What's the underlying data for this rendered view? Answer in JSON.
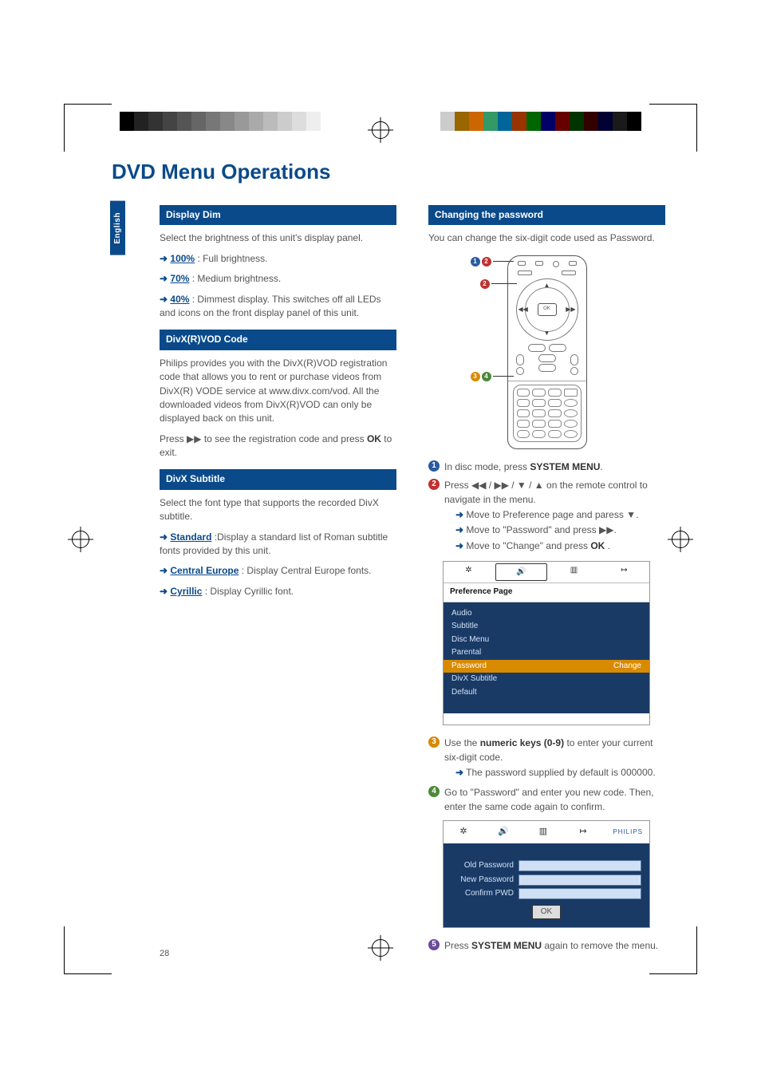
{
  "page_title": "DVD Menu Operations",
  "language_tab": "English",
  "page_number": "28",
  "left": {
    "section1_head": "Display Dim",
    "section1_intro": "Select the brightness of this unit's display panel.",
    "opt_100_label": "100%",
    "opt_100_desc": ": Full brightness.",
    "opt_70_label": "70%",
    "opt_70_desc": ": Medium brightness.",
    "opt_40_label": "40%",
    "opt_40_desc": ": Dimmest display. This switches off all LEDs and icons on the front display panel of this unit.",
    "section2_head": "DivX(R)VOD Code",
    "section2_body": "Philips provides you with the DivX(R)VOD registration code that allows you to rent or purchase videos from DivX(R) VODE service at www.divx.com/vod. All the downloaded videos from DivX(R)VOD can only be displayed back on this unit.",
    "section2_press_a": "Press ",
    "section2_press_b": " to see the registration code and press ",
    "section2_press_ok": "OK",
    "section2_press_c": " to exit.",
    "section3_head": "DivX Subtitle",
    "section3_intro": "Select the font type that supports the recorded DivX subtitle.",
    "opt_std_label": "Standard",
    "opt_std_desc": ":Display a standard list of Roman subtitle fonts provided by this unit.",
    "opt_ce_label": "Central Europe",
    "opt_ce_desc": ":  Display Central Europe fonts.",
    "opt_cy_label": "Cyrillic",
    "opt_cy_desc": ": Display Cyrillic font."
  },
  "right": {
    "section_head": "Changing the password",
    "intro": "You can change the six-digit code used as Password.",
    "step1_a": "In disc mode, press ",
    "step1_b": "SYSTEM MENU",
    "step1_c": ".",
    "step2_a": "Press ◀◀ / ▶▶ / ▼ / ▲ on the remote control to navigate in the menu.",
    "step2_sub1": " Move to Preference page and paress ▼.",
    "step2_sub2": " Move to \"Password\" and press ▶▶.",
    "step2_sub3": " Move to \"Change\" and press ",
    "step2_sub3_ok": "OK",
    "step2_sub3_end": " .",
    "osd1_title": "Preference Page",
    "osd1_items": {
      "audio": "Audio",
      "subtitle": "Subtitle",
      "discmenu": "Disc Menu",
      "parental": "Parental",
      "password": "Password",
      "password_val": "Change",
      "divxsub": "DivX Subtitle",
      "default": "Default"
    },
    "step3_a": "Use the ",
    "step3_b": "numeric keys (0-9)",
    "step3_c": " to enter your current six-digit code.",
    "step3_sub": " The password supplied by default is 000000.",
    "step4": "Go to \"Password\" and enter you new code. Then, enter the same code again to confirm.",
    "osd2_brand": "PHILIPS",
    "osd2_old": "Old Password",
    "osd2_new": "New Password",
    "osd2_confirm": "Confirm PWD",
    "osd2_ok": "OK",
    "step5_a": "Press ",
    "step5_b": "SYSTEM MENU",
    "step5_c": " again to remove the menu."
  },
  "remote": {
    "ok": "OK"
  }
}
